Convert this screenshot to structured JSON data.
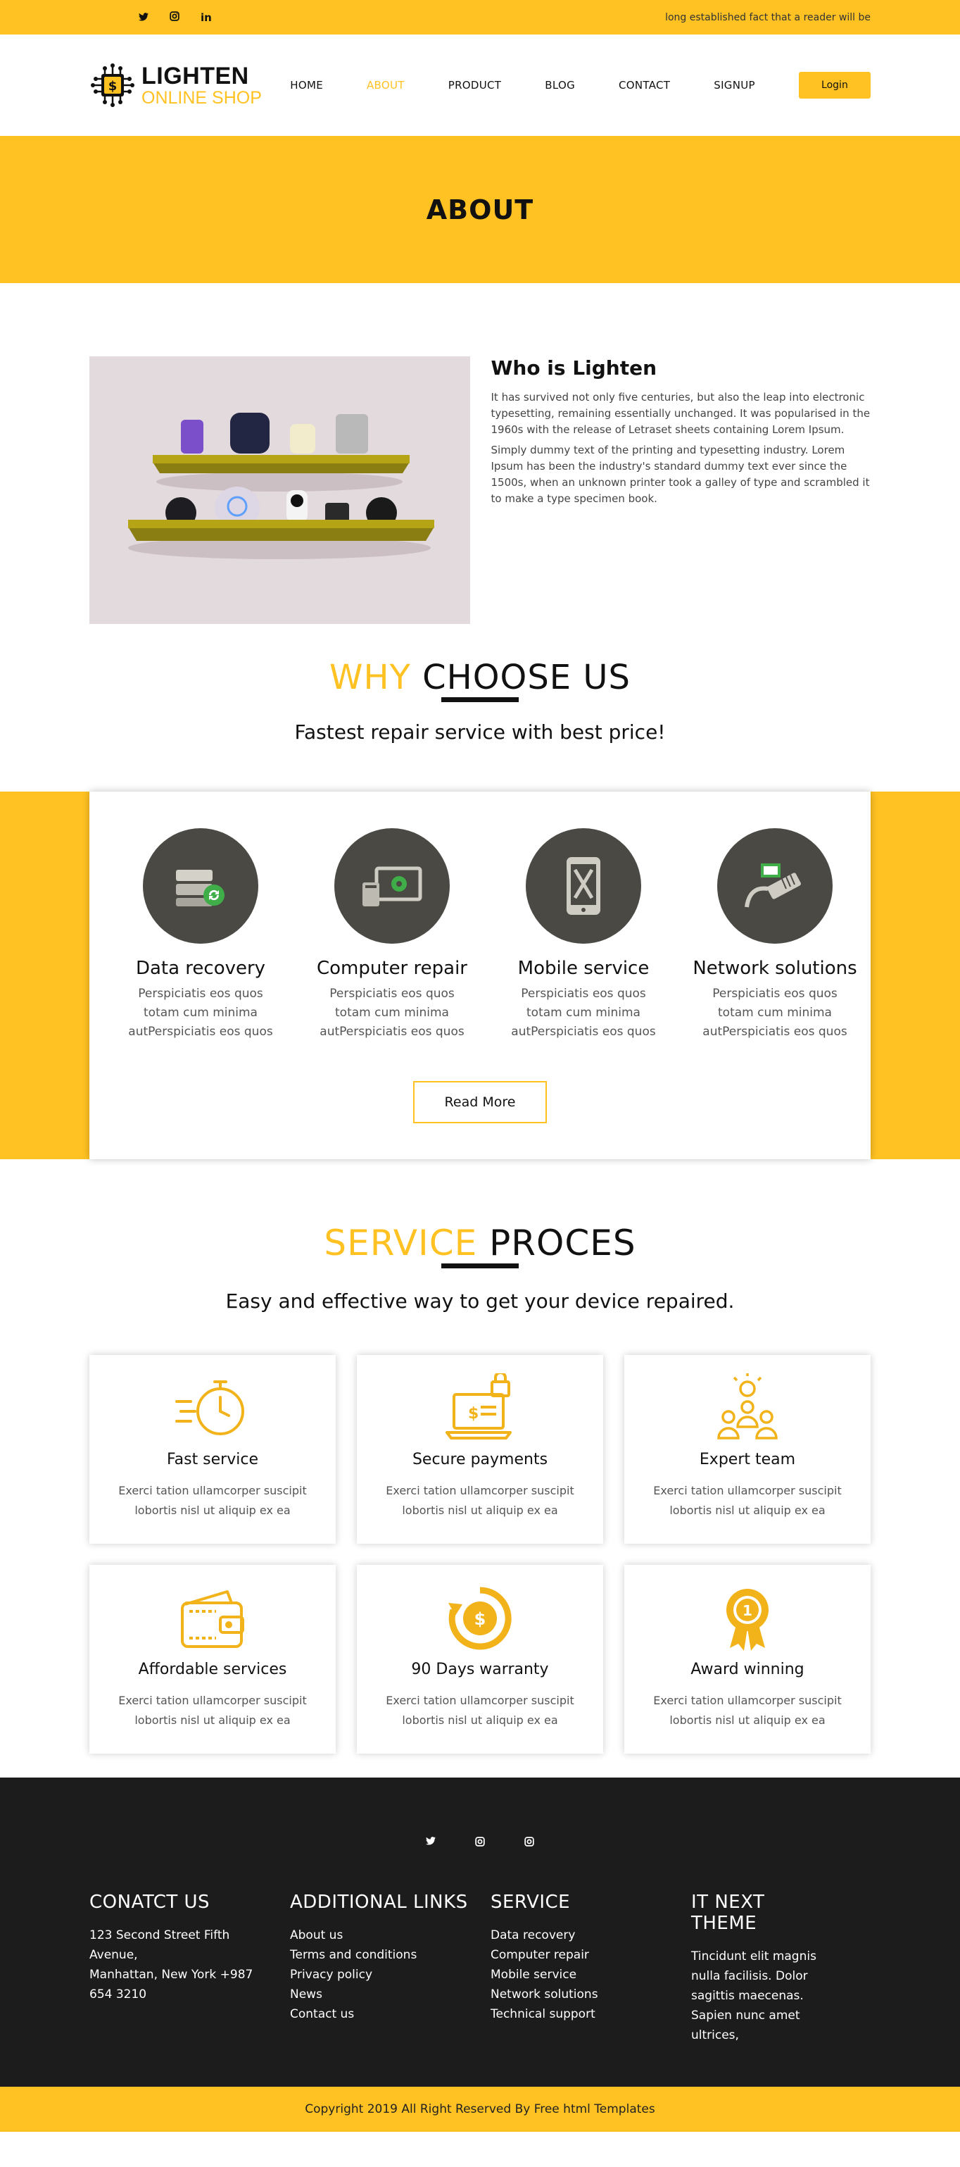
{
  "topbar": {
    "social": [
      {
        "icon": "twitter-icon",
        "glyph": "𝕥"
      },
      {
        "icon": "instagram-icon",
        "glyph": "◘"
      },
      {
        "icon": "linkedin-icon",
        "glyph": "in"
      }
    ],
    "note": "long established fact that a reader will be"
  },
  "header": {
    "logo_line1": "LIGHTEN",
    "logo_line2": "ONLINE SHOP",
    "nav": [
      "HOME",
      "ABOUT",
      "PRODUCT",
      "BLOG",
      "CONTACT",
      "SIGNUP"
    ],
    "active_nav": "ABOUT",
    "login_label": "Login"
  },
  "banner": {
    "title": "ABOUT"
  },
  "about": {
    "heading": "Who is Lighten",
    "p1": "It has survived not only five centuries, but also the leap into electronic typesetting, remaining essentially unchanged. It was popularised in the 1960s with the release of Letraset sheets containing Lorem Ipsum.",
    "p2": "Simply dummy text of the printing and typesetting industry. Lorem Ipsum has been the industry's standard dummy text ever since the 1500s, when an unknown printer took a galley of type and scrambled it to make a type specimen book."
  },
  "why": {
    "title_hi": "WHY ",
    "title_rest": "CHOOSE US",
    "subtitle": "Fastest repair service with best price!",
    "services": [
      {
        "title": "Data recovery",
        "desc": "Perspiciatis eos quos totam cum minima autPerspiciatis eos quos",
        "icon": "server-icon"
      },
      {
        "title": "Computer repair",
        "desc": "Perspiciatis eos quos totam cum minima autPerspiciatis eos quos",
        "icon": "computer-icon"
      },
      {
        "title": "Mobile service",
        "desc": "Perspiciatis eos quos totam cum minima autPerspiciatis eos quos",
        "icon": "mobile-icon"
      },
      {
        "title": "Network solutions",
        "desc": "Perspiciatis eos quos totam cum minima autPerspiciatis eos quos",
        "icon": "network-icon"
      }
    ],
    "read_more": "Read More"
  },
  "process": {
    "title_hi": "SERVICE ",
    "title_rest": "PROCES",
    "subtitle": "Easy and effective way to get your device repaired.",
    "cards": [
      {
        "title": "Fast service",
        "desc": "Exerci tation ullamcorper suscipit lobortis nisl ut aliquip ex ea",
        "icon": "stopwatch-icon"
      },
      {
        "title": "Secure payments",
        "desc": "Exerci tation ullamcorper suscipit lobortis nisl ut aliquip ex ea",
        "icon": "secure-payment-icon"
      },
      {
        "title": "Expert team",
        "desc": "Exerci tation ullamcorper suscipit lobortis nisl ut aliquip ex ea",
        "icon": "team-icon"
      },
      {
        "title": "Affordable services",
        "desc": "Exerci tation ullamcorper suscipit lobortis nisl ut aliquip ex ea",
        "icon": "wallet-icon"
      },
      {
        "title": "90 Days warranty",
        "desc": "Exerci tation ullamcorper suscipit lobortis nisl ut aliquip ex ea",
        "icon": "warranty-icon"
      },
      {
        "title": "Award winning",
        "desc": "Exerci tation ullamcorper suscipit lobortis nisl ut aliquip ex ea",
        "icon": "award-icon"
      }
    ]
  },
  "footer": {
    "social": [
      {
        "icon": "twitter-icon",
        "glyph": "𝕥"
      },
      {
        "icon": "instagram-icon",
        "glyph": "◘"
      },
      {
        "icon": "instagram-icon",
        "glyph": "◘"
      }
    ],
    "contact": {
      "heading": "CONATCT US",
      "lines": [
        "123 Second Street Fifth",
        "Avenue,",
        "Manhattan, New York +987",
        "654 3210"
      ]
    },
    "links": {
      "heading": "ADDITIONAL LINKS",
      "items": [
        "About us",
        "Terms and conditions",
        "Privacy policy",
        "News",
        "Contact us"
      ]
    },
    "service": {
      "heading": "SERVICE",
      "items": [
        "Data recovery",
        "Computer repair",
        "Mobile service",
        "Network solutions",
        "Technical support"
      ]
    },
    "theme": {
      "heading": "IT NEXT THEME",
      "lines": [
        "Tincidunt elit magnis",
        "nulla facilisis. Dolor",
        "sagittis maecenas.",
        "Sapien nunc amet",
        "ultrices,"
      ]
    },
    "copyright": "Copyright 2019 All Right Reserved By Free html Templates"
  },
  "colors": {
    "accent": "#ffc222",
    "dark": "#1c1c1c",
    "circle": "#4a4944"
  }
}
